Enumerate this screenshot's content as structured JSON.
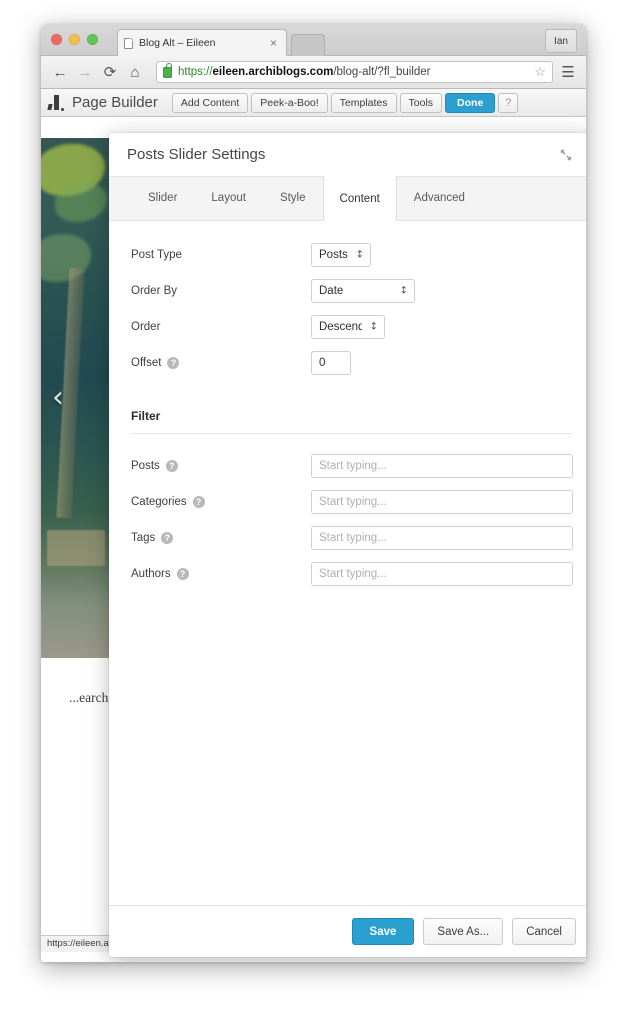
{
  "browser": {
    "tab": {
      "title": "Blog Alt – Eileen",
      "close_label": "×",
      "icon": "page-icon"
    },
    "new_tab_label": "",
    "profile_label": "Ian",
    "nav": {
      "back": "←",
      "forward": "→",
      "reload": "⟳",
      "home": "⌂"
    },
    "url": {
      "scheme": "https://",
      "host": "eileen.archiblogs.com",
      "path": "/blog-alt/?fl_builder",
      "full": "https://eileen.archiblogs.com/blog-alt/?fl_builder"
    },
    "star_icon": "☆",
    "menu_icon": "☰",
    "status_bar_text": "https://eileen.archiblogs.com/blog-alt..."
  },
  "page_builder_bar": {
    "title": "Page Builder",
    "buttons": [
      {
        "label": "Add Content",
        "style": "default"
      },
      {
        "label": "Peek-a-Boo!",
        "style": "default"
      },
      {
        "label": "Templates",
        "style": "default"
      },
      {
        "label": "Tools",
        "style": "default"
      },
      {
        "label": "Done",
        "style": "primary"
      }
    ],
    "help_label": "?"
  },
  "site_content": {
    "slider": {
      "prev_arrow": "‹",
      "next_arrow": "›"
    },
    "paragraph": "...earch and scour the weird and wonderful for great new"
  },
  "modal": {
    "title": "Posts Slider Settings",
    "collapse_icon": "collapse-icon",
    "tabs": [
      {
        "label": "Slider",
        "active": false
      },
      {
        "label": "Layout",
        "active": false
      },
      {
        "label": "Style",
        "active": false
      },
      {
        "label": "Content",
        "active": true
      },
      {
        "label": "Advanced",
        "active": false
      }
    ],
    "fields": {
      "post_type": {
        "label": "Post Type",
        "value": "Posts",
        "options": [
          "Posts"
        ]
      },
      "order_by": {
        "label": "Order By",
        "value": "Date",
        "options": [
          "Date"
        ]
      },
      "order": {
        "label": "Order",
        "value": "Descending",
        "options": [
          "Descending"
        ]
      },
      "offset": {
        "label": "Offset",
        "value": "0",
        "help": "?"
      }
    },
    "filter_section": {
      "heading": "Filter",
      "rows": [
        {
          "label": "Posts",
          "help": "?",
          "placeholder": "Start typing...",
          "value": ""
        },
        {
          "label": "Categories",
          "help": "?",
          "placeholder": "Start typing...",
          "value": ""
        },
        {
          "label": "Tags",
          "help": "?",
          "placeholder": "Start typing...",
          "value": ""
        },
        {
          "label": "Authors",
          "help": "?",
          "placeholder": "Start typing...",
          "value": ""
        }
      ]
    },
    "footer": {
      "save": "Save",
      "save_as": "Save As...",
      "cancel": "Cancel"
    }
  },
  "colors": {
    "accent": "#2b9fd0",
    "modal_bg": "#ffffff",
    "tab_bar_bg": "#f4f4f4",
    "border": "#e0e0e0"
  }
}
